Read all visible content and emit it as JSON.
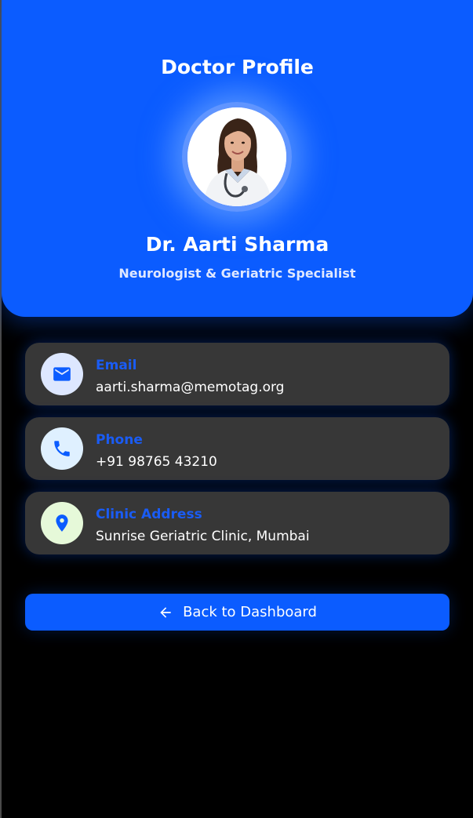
{
  "header": {
    "title": "Doctor Profile",
    "doctor_name": "Dr. Aarti Sharma",
    "specialty": "Neurologist & Geriatric Specialist"
  },
  "contact_cards": [
    {
      "label": "Email",
      "value": "aarti.sharma@memotag.org",
      "icon": "mail-icon",
      "icon_bg": "#dde7ff",
      "icon_color": "#0b5cff"
    },
    {
      "label": "Phone",
      "value": "+91 98765 43210",
      "icon": "phone-icon",
      "icon_bg": "#dff0ff",
      "icon_color": "#0b5cff"
    },
    {
      "label": "Clinic Address",
      "value": "Sunrise Geriatric Clinic, Mumbai",
      "icon": "location-pin-icon",
      "icon_bg": "#e6f9d9",
      "icon_color": "#0b5cff"
    }
  ],
  "actions": {
    "back_label": "Back to Dashboard"
  },
  "colors": {
    "accent": "#0b5cff",
    "card_bg": "#373737",
    "page_bg": "#000000"
  }
}
